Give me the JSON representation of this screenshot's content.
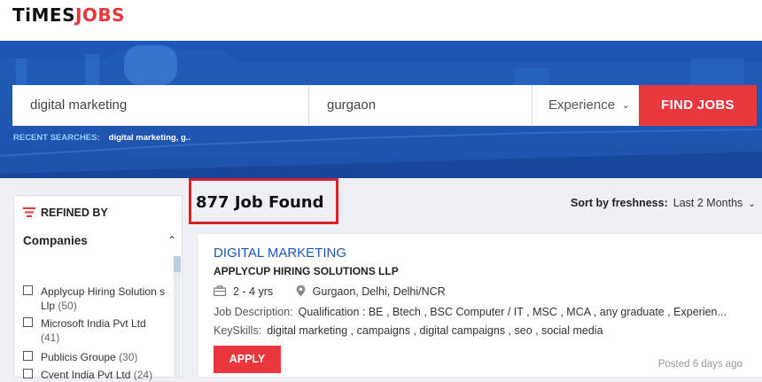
{
  "header": {
    "logo_times": "TiMES",
    "logo_jobs": "JOBS"
  },
  "search": {
    "keyword": "digital marketing",
    "location": "gurgaon",
    "experience": "Experience",
    "find_label": "FIND JOBS",
    "recent_label": "RECENT SEARCHES:",
    "recent_value": "digital marketing, g.."
  },
  "sidebar": {
    "refined_label": "REFINED BY",
    "companies_label": "Companies",
    "companies": [
      {
        "name": "Applycup Hiring Solution s Llp",
        "count": "(50)"
      },
      {
        "name": "Microsoft India Pvt Ltd",
        "count": "(41)"
      },
      {
        "name": "Publicis Groupe",
        "count": "(30)"
      },
      {
        "name": "Cvent India Pvt Ltd",
        "count": "(24)"
      }
    ]
  },
  "results": {
    "found_text": "877 Job Found",
    "sort_label": "Sort by freshness:",
    "sort_value": "Last 2 Months"
  },
  "job": {
    "title": "DIGITAL MARKETING",
    "company": "APPLYCUP HIRING SOLUTIONS LLP",
    "experience": "2 - 4 yrs",
    "location": "Gurgaon, Delhi, Delhi/NCR",
    "desc_label": "Job Description:",
    "description": "Qualification : BE , Btech , BSC Computer / IT , MSC , MCA , any graduate , Experien...",
    "skills_label": "KeySkills:",
    "skills": "digital marketing , campaigns , digital campaigns , seo , social media",
    "apply_label": "APPLY",
    "posted": "Posted 6 days ago"
  },
  "colors": {
    "brand_red": "#e8383d",
    "hero_blue": "#1d57b8",
    "link_blue": "#1d56b8",
    "highlight_box": "#d9212b"
  }
}
